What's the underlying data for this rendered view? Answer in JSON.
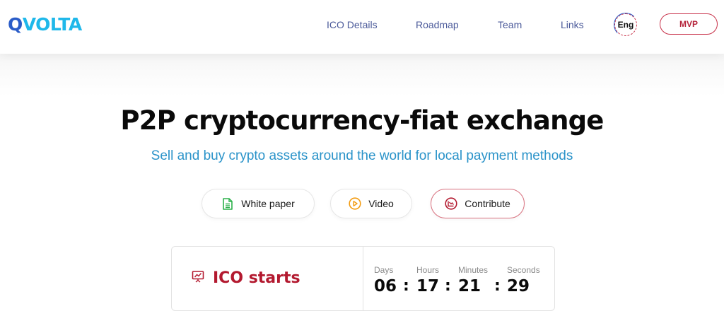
{
  "header": {
    "logo": {
      "q": "Q",
      "rest": "VOLTA"
    },
    "nav": [
      "ICO Details",
      "Roadmap",
      "Team",
      "Links"
    ],
    "lang": "Eng",
    "mvp": "MVP"
  },
  "hero": {
    "title": "P2P cryptocurrency-fiat exchange",
    "subtitle": "Sell and buy crypto assets around the world for local payment methods"
  },
  "actions": {
    "white_paper": "White paper",
    "video": "Video",
    "contribute": "Contribute"
  },
  "ico": {
    "label": "ICO starts",
    "units": [
      "Days",
      "Hours",
      "Minutes",
      "Seconds"
    ],
    "values": [
      "06",
      "17",
      "21",
      "29"
    ],
    "separator": ":"
  },
  "colors": {
    "accent_red": "#b3192f",
    "link_blue": "#2a93c9",
    "nav_blue": "#4b5a9a",
    "icon_green": "#2bb04a",
    "icon_orange": "#f39c12"
  }
}
